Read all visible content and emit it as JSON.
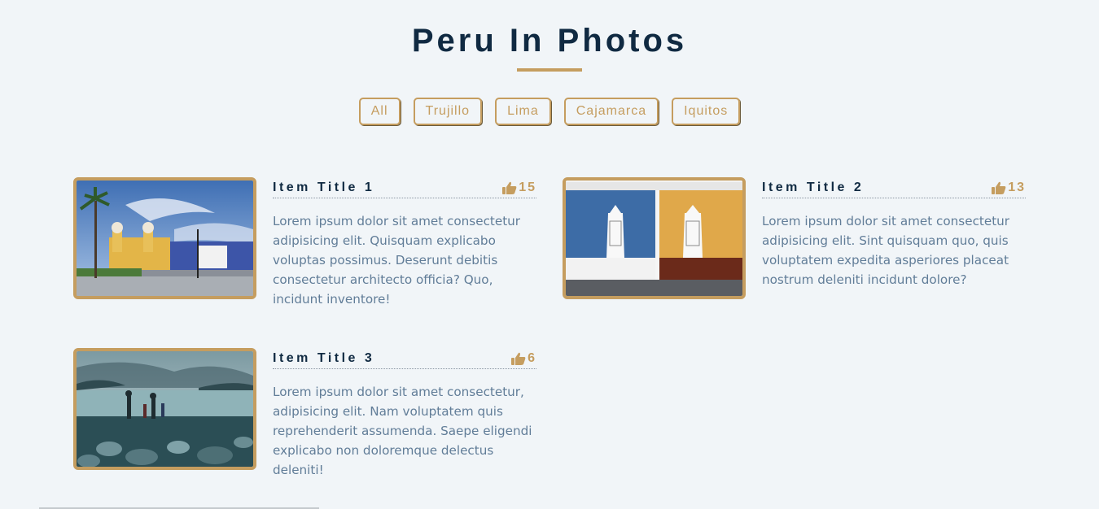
{
  "page": {
    "title": "Peru In Photos",
    "accent": "#c59d5f",
    "heading_color": "#102a42",
    "text_color": "#617d98"
  },
  "filters": [
    {
      "label": "All"
    },
    {
      "label": "Trujillo"
    },
    {
      "label": "Lima"
    },
    {
      "label": "Cajamarca"
    },
    {
      "label": "Iquitos"
    }
  ],
  "items": [
    {
      "title": "Item Title 1",
      "likes": "15",
      "like_icon": "thumbs-up-icon",
      "description": "Lorem ipsum dolor sit amet consectetur adipisicing elit. Quisquam explicabo voluptas possimus. Deserunt debitis consectetur architecto officia? Quo, incidunt inventore!"
    },
    {
      "title": "Item Title 2",
      "likes": "13",
      "like_icon": "thumbs-up-icon",
      "description": "Lorem ipsum dolor sit amet consectetur adipisicing elit. Sint quisquam quo, quis voluptatem expedita asperiores placeat nostrum deleniti incidunt dolore?"
    },
    {
      "title": "Item Title 3",
      "likes": "6",
      "like_icon": "thumbs-up-icon",
      "description": "Lorem ipsum dolor sit amet consectetur, adipisicing elit. Nam voluptatem quis reprehenderit assumenda. Saepe eligendi explicabo non doloremque delectus deleniti!"
    }
  ]
}
